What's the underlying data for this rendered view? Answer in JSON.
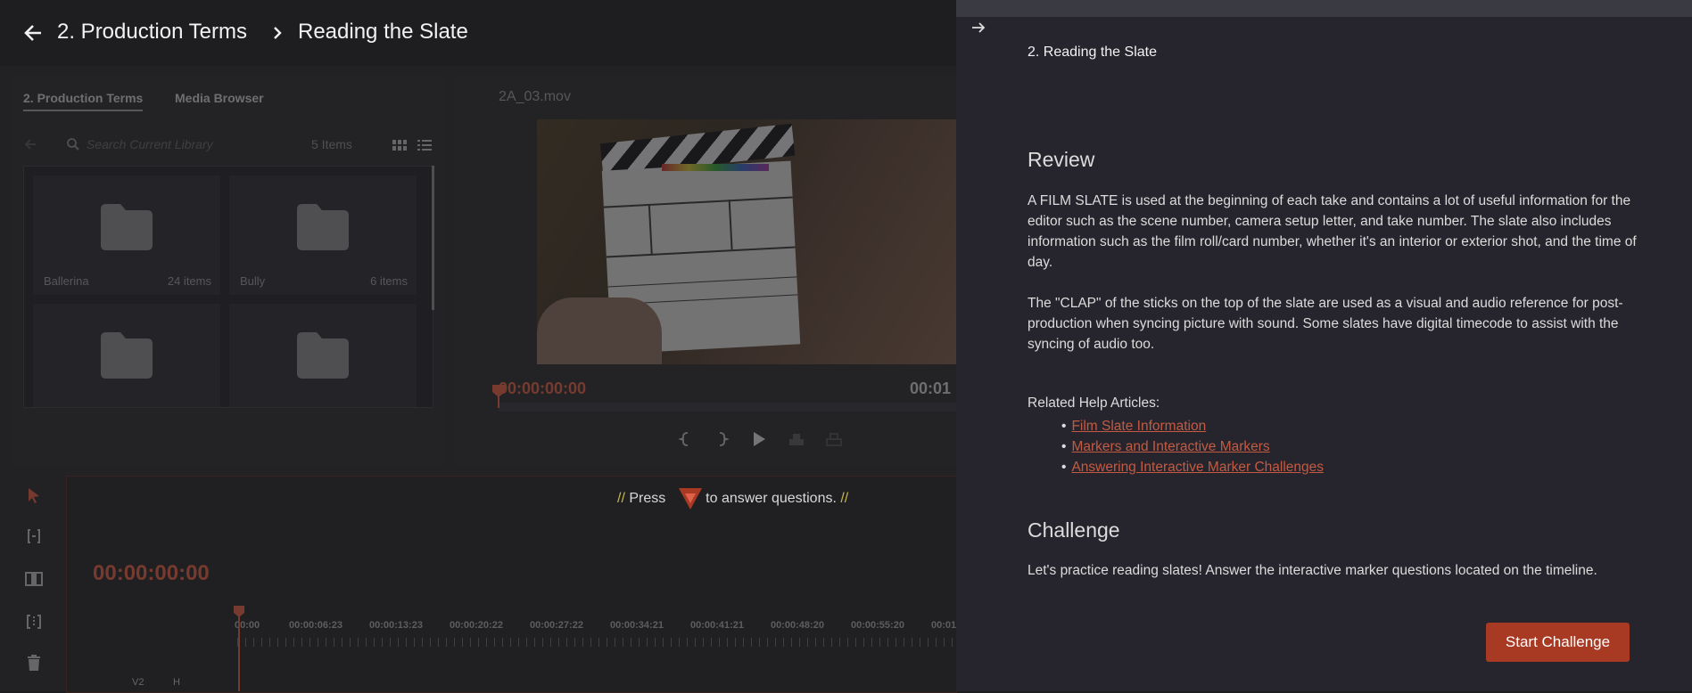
{
  "header": {
    "breadcrumb_1": "2. Production Terms",
    "breadcrumb_2": "Reading the Slate"
  },
  "library": {
    "tabs": [
      "2. Production Terms",
      "Media Browser"
    ],
    "search_placeholder": "Search Current Library",
    "items_count": "5 Items",
    "folders": [
      {
        "name": "Ballerina",
        "count": "24 items"
      },
      {
        "name": "Bully",
        "count": "6 items"
      },
      {
        "name": "",
        "count": ""
      },
      {
        "name": "",
        "count": ""
      }
    ]
  },
  "viewer": {
    "clip_name": "2A_03.mov",
    "timecode_current": "00:00:00:00",
    "timecode_end": "00:01"
  },
  "timeline": {
    "press_prefix": "//",
    "press_text_1": "Press",
    "press_text_2": "to answer questions.",
    "press_suffix": "//",
    "timecode": "00:00:00:00",
    "ruler_labels": [
      "00:00",
      "00:00:06:23",
      "00:00:13:23",
      "00:00:20:22",
      "00:00:27:22",
      "00:00:34:21",
      "00:00:41:21",
      "00:00:48:20",
      "00:00:55:20",
      "00:01"
    ],
    "track_labels": [
      "V2",
      "H"
    ]
  },
  "panel": {
    "subtitle": "2. Reading the Slate",
    "review_heading": "Review",
    "review_p1": "A FILM SLATE is used at the beginning of each take and contains a lot of useful information for the editor such as the scene number, camera setup letter, and take number. The slate also includes information such as the film roll/card number, whether it's an interior or exterior shot, and the time of day.",
    "review_p2": "The \"CLAP\" of the sticks on the top of the slate are used as a visual and audio reference for post-production when syncing picture with sound. Some slates have digital timecode to assist with the syncing of audio too.",
    "related_label": "Related Help Articles:",
    "related_links": [
      "Film Slate Information",
      "Markers and Interactive Markers",
      "Answering Interactive Marker Challenges"
    ],
    "challenge_heading": "Challenge",
    "challenge_text": "Let's practice reading slates! Answer the interactive marker questions located on the timeline.",
    "start_button": "Start Challenge"
  },
  "colors": {
    "accent": "#a83a24",
    "link": "#c45a42",
    "timecode": "#e05a3a",
    "panel_bg": "#26252d"
  }
}
